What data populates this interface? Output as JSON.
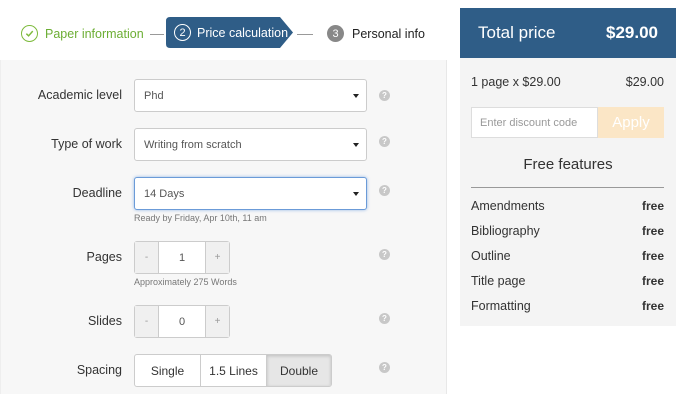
{
  "steps": [
    {
      "label": "Paper information",
      "state": "done"
    },
    {
      "number": "2",
      "label": "Price calculation",
      "state": "active"
    },
    {
      "number": "3",
      "label": "Personal info",
      "state": "pending"
    }
  ],
  "form": {
    "academic_level": {
      "label": "Academic level",
      "value": "Phd"
    },
    "type_of_work": {
      "label": "Type of work",
      "value": "Writing from scratch"
    },
    "deadline": {
      "label": "Deadline",
      "value": "14 Days",
      "hint": "Ready by Friday, Apr 10th, 11 am"
    },
    "pages": {
      "label": "Pages",
      "value": "1",
      "minus": "-",
      "plus": "+",
      "hint": "Approximately 275 Words"
    },
    "slides": {
      "label": "Slides",
      "value": "0",
      "minus": "-",
      "plus": "+"
    },
    "spacing": {
      "label": "Spacing",
      "options": [
        "Single",
        "1.5 Lines",
        "Double"
      ],
      "selected": "Double"
    },
    "help_glyph": "?"
  },
  "summary": {
    "total_label": "Total price",
    "total_value": "$29.00",
    "line_item_label": "1 page x $29.00",
    "line_item_value": "$29.00",
    "discount_placeholder": "Enter discount code",
    "apply_label": "Apply",
    "features_title": "Free features",
    "features": [
      {
        "name": "Amendments",
        "value": "free"
      },
      {
        "name": "Bibliography",
        "value": "free"
      },
      {
        "name": "Outline",
        "value": "free"
      },
      {
        "name": "Title page",
        "value": "free"
      },
      {
        "name": "Formatting",
        "value": "free"
      }
    ]
  },
  "colors": {
    "accent": "#2f5d87",
    "done_green": "#6cae34",
    "apply_bg": "#fbe6c6",
    "focus_border": "#6b9bd8"
  }
}
